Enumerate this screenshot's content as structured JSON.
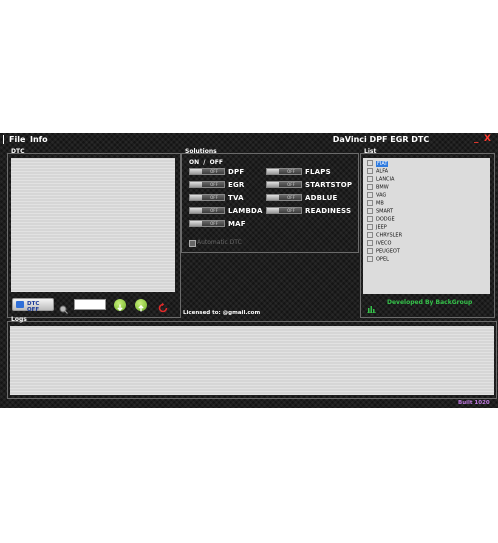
{
  "window": {
    "title": "DaVinci DPF EGR DTC",
    "minimize_glyph": "_",
    "close_glyph": "X"
  },
  "menu": [
    {
      "label": "File"
    },
    {
      "label": "Info"
    }
  ],
  "dtc": {
    "title": "DTC",
    "dtc_off_label": "DTC OFF",
    "code_input_value": ""
  },
  "solutions": {
    "title": "Solutions",
    "on_off_header": "ON  /  OFF",
    "left": [
      {
        "label": "DPF",
        "state": "OFF"
      },
      {
        "label": "EGR",
        "state": "OFF"
      },
      {
        "label": "TVA",
        "state": "OFF"
      },
      {
        "label": "LAMBDA",
        "state": "OFF"
      },
      {
        "label": "MAF",
        "state": "OFF"
      }
    ],
    "right": [
      {
        "label": "FLAPS",
        "state": "OFF"
      },
      {
        "label": "STARTSTOP",
        "state": "OFF"
      },
      {
        "label": "ADBLUE",
        "state": "OFF"
      },
      {
        "label": "READINESS",
        "state": "OFF"
      }
    ],
    "automatic_dtc_label": "Automatic DTC",
    "licensed_text": "Licensed to: @gmail.com"
  },
  "list": {
    "title": "List",
    "items": [
      "FIAT",
      "ALFA",
      "LANCIA",
      "BMW",
      "VAG",
      "MB",
      "SMART",
      "DODGE",
      "JEEP",
      "CHRYSLER",
      "IVECO",
      "PEUGEOT",
      "OPEL"
    ],
    "selected": "FIAT",
    "developed_by": "Developed By BackGroup"
  },
  "logs": {
    "title": "Logs"
  },
  "build": {
    "label": "Built 1020"
  },
  "colors": {
    "accent_green": "#35c24a",
    "close_red": "#ff3b30",
    "build_purple": "#c07ae0",
    "selection_blue": "#2f7be0"
  },
  "icons": [
    "zoom-icon",
    "download-icon",
    "upload-icon",
    "refresh-icon",
    "chart-icon"
  ]
}
